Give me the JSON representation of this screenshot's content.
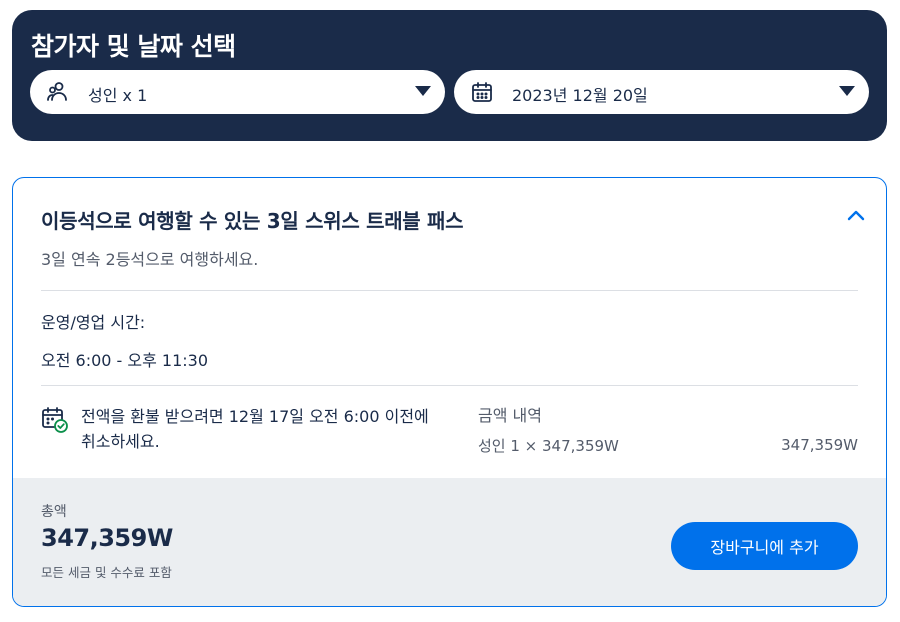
{
  "selector": {
    "title": "참가자 및 날짜 선택",
    "participants": {
      "value": "성인 x 1",
      "icon": "people-icon"
    },
    "date": {
      "value": "2023년 12월 20일",
      "icon": "calendar-icon"
    }
  },
  "option": {
    "title": "이등석으로 여행할 수 있는 3일 스위스 트래블 패스",
    "subtitle": "3일 연속 2등석으로 여행하세요.",
    "hours_label": "운영/영업 시간:",
    "hours_value": "오전 6:00 - 오후 11:30",
    "cancellation": "전액을 환불 받으려면 12월 17일 오전 6:00 이전에 취소하세요.",
    "price_breakdown_label": "금액 내역",
    "price_line_label": "성인 1 × 347,359W",
    "price_line_value": "347,359W",
    "total_label": "총액",
    "total_value": "347,359W",
    "total_note": "모든 세금 및 수수료 포함",
    "add_to_cart": "장바구니에 추가"
  },
  "colors": {
    "navy": "#1a2b49",
    "accent": "#0071eb",
    "muted_text": "#545c6b",
    "total_bg": "#ebeef1"
  }
}
